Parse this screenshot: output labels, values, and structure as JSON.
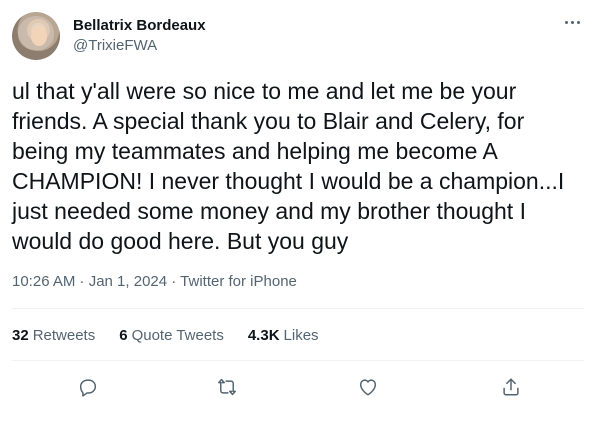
{
  "user": {
    "display_name": "Bellatrix Bordeaux",
    "handle": "@TrixieFWA"
  },
  "tweet": {
    "text": "ul that y'all were so nice to me and let me be your\nfriends. A special thank you to Blair and Celery, for\nbeing my teammates and helping me become A\nCHAMPION! I never thought I would be a champion...I\njust needed some money and my brother thought I\nwould do good here. But you guy",
    "meta": "10:26 AM · Jan 1, 2024 · Twitter for iPhone"
  },
  "stats": {
    "retweets_count": "32",
    "retweets_label": "Retweets",
    "quote_count": "6",
    "quote_label": "Quote Tweets",
    "likes_count": "4.3K",
    "likes_label": "Likes"
  },
  "icons": {
    "more": "more-horizontal-icon",
    "reply": "reply-icon",
    "retweet": "retweet-icon",
    "like": "heart-icon",
    "share": "share-icon"
  },
  "colors": {
    "text": "#0f1419",
    "secondary": "#536471",
    "divider": "#eff3f4"
  }
}
